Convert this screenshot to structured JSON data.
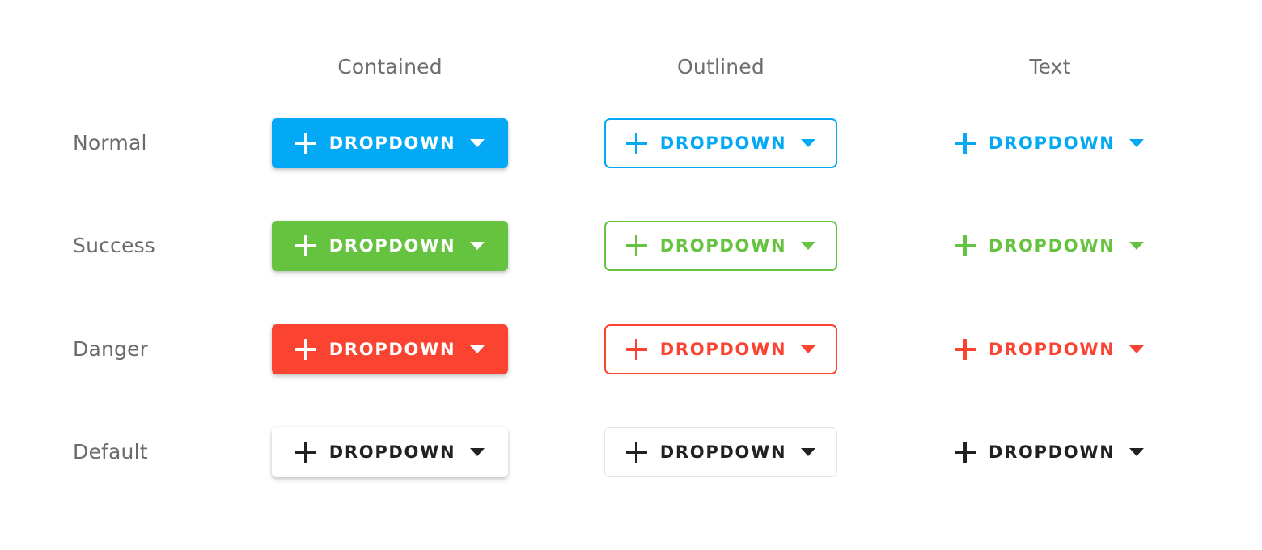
{
  "columns": [
    {
      "key": "contained",
      "label": "Contained"
    },
    {
      "key": "outlined",
      "label": "Outlined"
    },
    {
      "key": "text",
      "label": "Text"
    }
  ],
  "rows": [
    {
      "key": "normal",
      "label": "Normal"
    },
    {
      "key": "success",
      "label": "Success"
    },
    {
      "key": "danger",
      "label": "Danger"
    },
    {
      "key": "default",
      "label": "Default"
    }
  ],
  "button": {
    "label": "DROPDOWN",
    "plus_icon": "plus-icon",
    "caret_icon": "caret-down-icon"
  },
  "colors": {
    "normal": "#03a9f4",
    "success": "#66c340",
    "danger": "#fb4332",
    "default": "#212121",
    "default_border": "#e4e4e4",
    "surface": "#ffffff",
    "label_text": "#6b6b6b",
    "header_text": "#6e6e6e"
  }
}
